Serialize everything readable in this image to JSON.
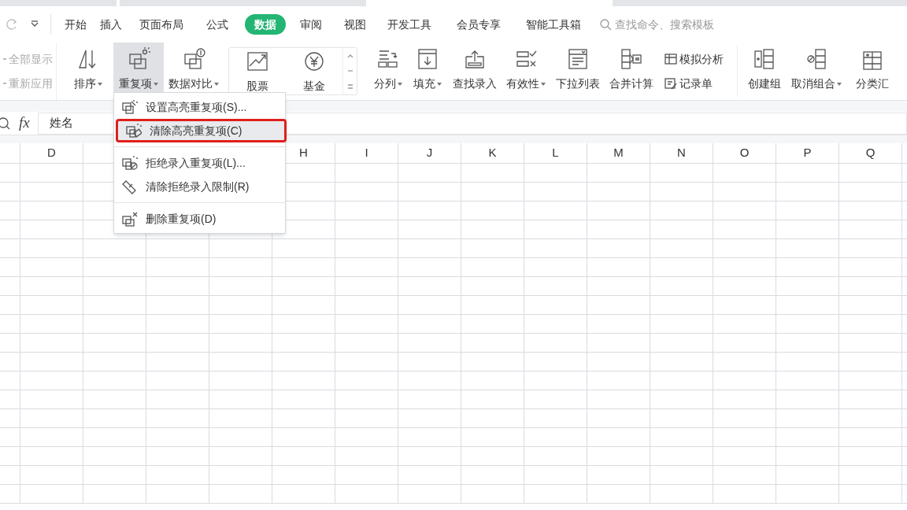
{
  "menu_tabs": [
    {
      "label": "开始",
      "selected": false
    },
    {
      "label": "插入",
      "selected": false
    },
    {
      "label": "页面布局",
      "selected": false
    },
    {
      "label": "公式",
      "selected": false
    },
    {
      "label": "数据",
      "selected": true
    },
    {
      "label": "审阅",
      "selected": false
    },
    {
      "label": "视图",
      "selected": false
    },
    {
      "label": "开发工具",
      "selected": false
    },
    {
      "label": "会员专享",
      "selected": false
    },
    {
      "label": "智能工具箱",
      "selected": false
    }
  ],
  "search": {
    "placeholder": "查找命令、搜索模板"
  },
  "ribbon": [
    {
      "kind": "stack",
      "items": [
        {
          "label": "全部显示",
          "disabled": true
        },
        {
          "label": "重新应用",
          "disabled": true
        }
      ]
    },
    {
      "kind": "large",
      "label": "排序",
      "dropdown": true,
      "selected": false
    },
    {
      "kind": "large",
      "label": "重复项",
      "dropdown": true,
      "selected": true
    },
    {
      "kind": "large",
      "label": "数据对比",
      "dropdown": true,
      "selected": false
    },
    {
      "kind": "gallery",
      "items": [
        {
          "label": "股票"
        },
        {
          "label": "基金"
        }
      ]
    },
    {
      "kind": "large",
      "label": "分列",
      "dropdown": true,
      "selected": false
    },
    {
      "kind": "large",
      "label": "填充",
      "dropdown": true,
      "selected": false
    },
    {
      "kind": "large",
      "label": "查找录入",
      "dropdown": false,
      "selected": false
    },
    {
      "kind": "large",
      "label": "有效性",
      "dropdown": true,
      "selected": false
    },
    {
      "kind": "large",
      "label": "下拉列表",
      "dropdown": false,
      "selected": false
    },
    {
      "kind": "large",
      "label": "合并计算",
      "dropdown": false,
      "selected": false
    },
    {
      "kind": "stack",
      "items": [
        {
          "label": "模拟分析",
          "disabled": false
        },
        {
          "label": "记录单",
          "disabled": false
        }
      ]
    },
    {
      "kind": "separator"
    },
    {
      "kind": "large",
      "label": "创建组",
      "dropdown": false,
      "selected": false
    },
    {
      "kind": "large",
      "label": "取消组合",
      "dropdown": true,
      "selected": false
    },
    {
      "kind": "large",
      "label": "分类汇",
      "dropdown": false,
      "selected": false
    }
  ],
  "formula_bar": {
    "fx": "fx",
    "value": "姓名"
  },
  "dropdown_menu": [
    {
      "label": "设置高亮重复项(S)...",
      "selected": false,
      "divider_after": false
    },
    {
      "label": "清除高亮重复项(C)",
      "selected": true,
      "divider_after": true
    },
    {
      "label": "拒绝录入重复项(L)...",
      "selected": false,
      "divider_after": false
    },
    {
      "label": "清除拒绝录入限制(R)",
      "selected": false,
      "divider_after": true
    },
    {
      "label": "删除重复项(D)",
      "selected": false,
      "divider_after": false
    }
  ],
  "column_headers": [
    "D",
    "H",
    "I",
    "J",
    "K",
    "L",
    "M",
    "N",
    "O",
    "P",
    "Q"
  ]
}
